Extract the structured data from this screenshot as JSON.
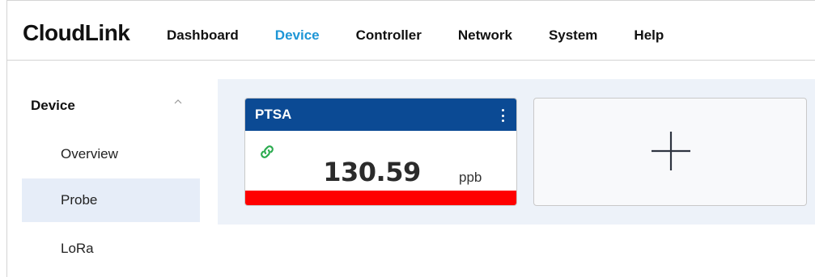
{
  "app": {
    "title": "CloudLink"
  },
  "nav": {
    "items": [
      {
        "label": "Dashboard"
      },
      {
        "label": "Device"
      },
      {
        "label": "Controller"
      },
      {
        "label": "Network"
      },
      {
        "label": "System"
      },
      {
        "label": "Help"
      }
    ],
    "active": "Device"
  },
  "sidebar": {
    "group_label": "Device",
    "group_icon": "chevron-up-icon",
    "items": [
      {
        "label": "Overview"
      },
      {
        "label": "Probe"
      },
      {
        "label": "LoRa"
      }
    ],
    "active": "Probe"
  },
  "device_card": {
    "title": "PTSA",
    "value": "130.59",
    "unit": "ppb",
    "menu_icon": "kebab-menu-icon",
    "status_icon": "link-icon",
    "colors": {
      "header": "#0b4a94",
      "status_bar": "#ff0000",
      "link_icon": "#2bab4f"
    }
  },
  "add_card": {
    "icon": "plus-icon"
  },
  "colors": {
    "accent": "#1e96d6",
    "active_bg": "#e6edf8",
    "panel_bg": "#edf2f9"
  }
}
